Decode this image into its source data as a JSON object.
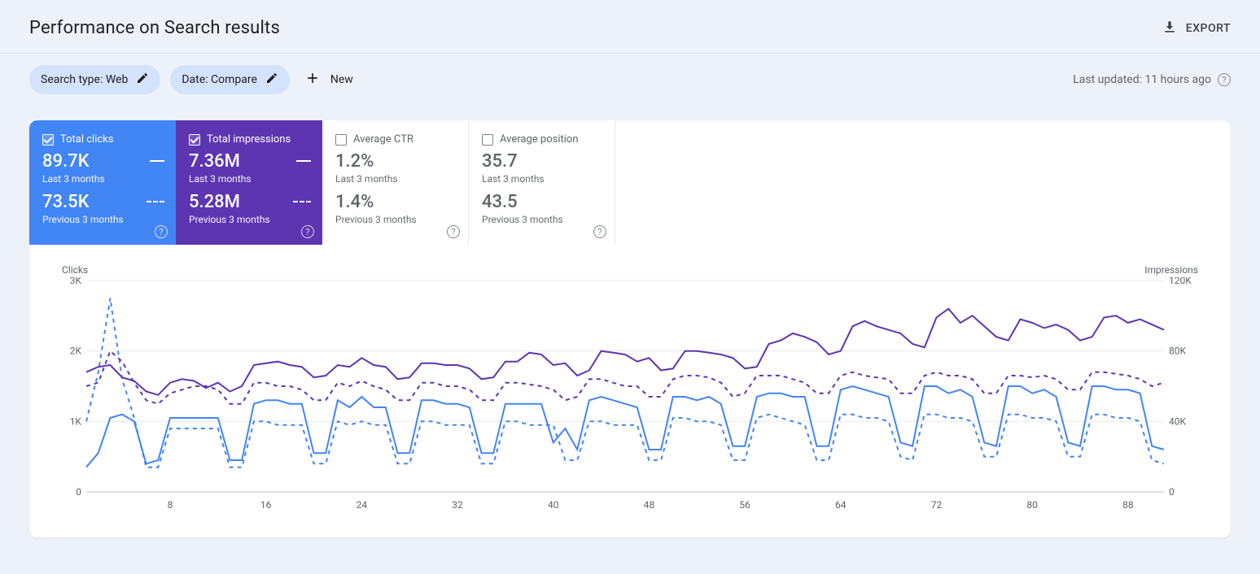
{
  "header": {
    "title": "Performance on Search results",
    "export": "EXPORT"
  },
  "filters": {
    "search_type_chip": "Search type: Web",
    "date_chip": "Date: Compare",
    "new": "New",
    "last_updated": "Last updated: 11 hours ago"
  },
  "metrics": {
    "clicks": {
      "label": "Total clicks",
      "cur_value": "89.7K",
      "cur_period": "Last 3 months",
      "prev_value": "73.5K",
      "prev_period": "Previous 3 months",
      "active": true,
      "color": "#4285f4"
    },
    "impressions": {
      "label": "Total impressions",
      "cur_value": "7.36M",
      "cur_period": "Last 3 months",
      "prev_value": "5.28M",
      "prev_period": "Previous 3 months",
      "active": true,
      "color": "#5e35b1"
    },
    "ctr": {
      "label": "Average CTR",
      "cur_value": "1.2%",
      "cur_period": "Last 3 months",
      "prev_value": "1.4%",
      "prev_period": "Previous 3 months",
      "active": false
    },
    "position": {
      "label": "Average position",
      "cur_value": "35.7",
      "cur_period": "Last 3 months",
      "prev_value": "43.5",
      "prev_period": "Previous 3 months",
      "active": false
    }
  },
  "chart_data": {
    "type": "line",
    "left_axis": {
      "label": "Clicks",
      "ticks": [
        "0",
        "1K",
        "2K",
        "3K"
      ],
      "min": 0,
      "max": 3000
    },
    "right_axis": {
      "label": "Impressions",
      "ticks": [
        "0",
        "40K",
        "80K",
        "120K"
      ],
      "min": 0,
      "max": 120000
    },
    "x": {
      "ticks": [
        8,
        16,
        24,
        32,
        40,
        48,
        56,
        64,
        72,
        80,
        88
      ],
      "min": 1,
      "max": 91
    },
    "series": [
      {
        "name": "Clicks (Last 3 months)",
        "axis": "left",
        "style": "solid",
        "color": "#4285f4",
        "values": [
          350,
          550,
          1050,
          1100,
          1000,
          400,
          450,
          1050,
          1050,
          1050,
          1050,
          1050,
          450,
          450,
          1250,
          1300,
          1300,
          1250,
          1250,
          550,
          550,
          1300,
          1200,
          1350,
          1200,
          1200,
          550,
          550,
          1300,
          1300,
          1250,
          1250,
          1200,
          550,
          550,
          1250,
          1250,
          1250,
          1250,
          700,
          900,
          600,
          1300,
          1350,
          1300,
          1250,
          1200,
          600,
          600,
          1350,
          1350,
          1300,
          1350,
          1250,
          650,
          650,
          1350,
          1400,
          1400,
          1350,
          1350,
          650,
          650,
          1450,
          1500,
          1450,
          1400,
          1350,
          700,
          650,
          1500,
          1500,
          1400,
          1450,
          1350,
          700,
          650,
          1500,
          1500,
          1400,
          1450,
          1350,
          700,
          650,
          1500,
          1500,
          1450,
          1450,
          1400,
          650,
          600
        ]
      },
      {
        "name": "Clicks (Previous 3 months)",
        "axis": "left",
        "style": "dashed",
        "color": "#4285f4",
        "values": [
          1000,
          1700,
          2750,
          1600,
          1050,
          350,
          350,
          900,
          900,
          900,
          900,
          900,
          350,
          350,
          1000,
          1000,
          950,
          950,
          950,
          400,
          400,
          1000,
          950,
          1000,
          950,
          950,
          400,
          400,
          1000,
          1000,
          950,
          950,
          950,
          400,
          400,
          1000,
          1000,
          950,
          950,
          950,
          450,
          450,
          1000,
          1000,
          950,
          950,
          950,
          450,
          450,
          1050,
          1050,
          1000,
          1000,
          950,
          450,
          450,
          1050,
          1100,
          1050,
          1000,
          950,
          450,
          450,
          1100,
          1100,
          1050,
          1050,
          1000,
          500,
          450,
          1100,
          1100,
          1050,
          1050,
          1000,
          500,
          500,
          1100,
          1100,
          1050,
          1050,
          1000,
          500,
          500,
          1100,
          1100,
          1050,
          1050,
          1000,
          450,
          400
        ]
      },
      {
        "name": "Impressions (Last 3 months)",
        "axis": "right",
        "style": "solid",
        "color": "#5e35b1",
        "values": [
          68000,
          71000,
          72000,
          65000,
          63000,
          57000,
          55000,
          62000,
          64000,
          63000,
          59000,
          62000,
          57000,
          60000,
          72000,
          73000,
          74000,
          72000,
          71000,
          65000,
          66000,
          72000,
          71000,
          76000,
          72000,
          71000,
          64000,
          65000,
          73000,
          73000,
          72000,
          72000,
          70000,
          64000,
          65000,
          74000,
          74000,
          79000,
          78000,
          72000,
          73000,
          66000,
          69000,
          80000,
          79000,
          78000,
          74000,
          76000,
          69000,
          70000,
          80000,
          80000,
          79000,
          78000,
          76000,
          70000,
          71000,
          84000,
          86000,
          90000,
          88000,
          85000,
          78000,
          80000,
          94000,
          97000,
          94000,
          92000,
          90000,
          84000,
          82000,
          99000,
          104000,
          96000,
          100000,
          94000,
          88000,
          86000,
          98000,
          96000,
          93000,
          95000,
          92000,
          86000,
          88000,
          99000,
          100000,
          96000,
          98000,
          95000,
          92000
        ]
      },
      {
        "name": "Impressions (Previous 3 months)",
        "axis": "right",
        "style": "dashed",
        "color": "#5e35b1",
        "values": [
          60000,
          62000,
          80000,
          74000,
          62000,
          52000,
          50000,
          56000,
          58000,
          60000,
          60000,
          58000,
          50000,
          50000,
          62000,
          62000,
          60000,
          60000,
          58000,
          52000,
          52000,
          62000,
          60000,
          63000,
          60000,
          58000,
          52000,
          52000,
          62000,
          62000,
          60000,
          60000,
          58000,
          52000,
          52000,
          62000,
          62000,
          61000,
          60000,
          58000,
          52000,
          54000,
          64000,
          64000,
          62000,
          60000,
          60000,
          54000,
          54000,
          64000,
          66000,
          66000,
          65000,
          62000,
          54000,
          56000,
          66000,
          66000,
          66000,
          64000,
          62000,
          56000,
          56000,
          66000,
          68000,
          66000,
          65000,
          64000,
          56000,
          56000,
          66000,
          68000,
          66000,
          66000,
          64000,
          56000,
          56000,
          66000,
          66000,
          65000,
          66000,
          64000,
          58000,
          58000,
          68000,
          68000,
          67000,
          66000,
          64000,
          60000,
          62000
        ]
      }
    ]
  }
}
